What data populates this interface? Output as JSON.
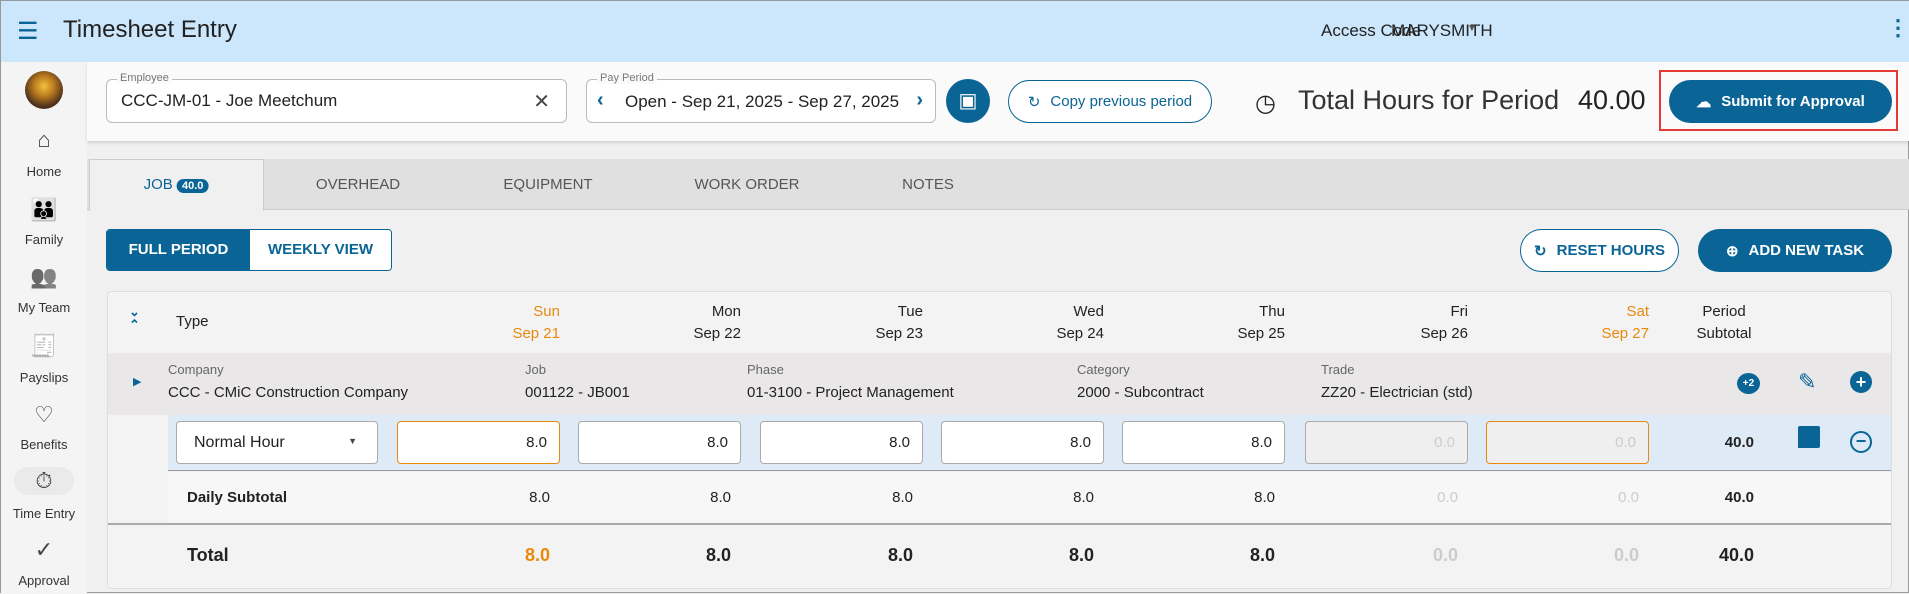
{
  "header": {
    "title": "Timesheet Entry",
    "access_code_label": "Access Code",
    "access_code_value": "MARYSMITH"
  },
  "sidebar": {
    "items": [
      {
        "label": "Home",
        "icon": "home-icon"
      },
      {
        "label": "Family",
        "icon": "family-icon"
      },
      {
        "label": "My Team",
        "icon": "team-icon"
      },
      {
        "label": "Payslips",
        "icon": "payslip-icon"
      },
      {
        "label": "Benefits",
        "icon": "benefits-icon"
      },
      {
        "label": "Time Entry",
        "icon": "timer-icon",
        "active": true
      },
      {
        "label": "Approval",
        "icon": "approval-icon"
      }
    ]
  },
  "toolbar": {
    "employee_label": "Employee",
    "employee_value": "CCC-JM-01 - Joe Meetchum",
    "pay_period_label": "Pay Period",
    "pay_period_value": "Open - Sep 21, 2025 - Sep 27, 2025",
    "copy_label": "Copy previous period",
    "total_label": "Total Hours for Period",
    "total_value": "40.00",
    "submit_label": "Submit for Approval"
  },
  "tabs": [
    {
      "label": "JOB",
      "badge": "40.0"
    },
    {
      "label": "OVERHEAD"
    },
    {
      "label": "EQUIPMENT"
    },
    {
      "label": "WORK ORDER"
    },
    {
      "label": "NOTES"
    }
  ],
  "view": {
    "full_period": "FULL PERIOD",
    "weekly": "WEEKLY VIEW",
    "reset": "RESET HOURS",
    "add_task": "ADD NEW TASK"
  },
  "table": {
    "type_label": "Type",
    "period_subtotal": [
      "Period",
      "Subtotal"
    ],
    "days": [
      {
        "day": "Sun",
        "date": "Sep 21",
        "weekend": true,
        "hours": "8.0",
        "subtotal": "8.0",
        "total": "8.0"
      },
      {
        "day": "Mon",
        "date": "Sep 22",
        "hours": "8.0",
        "subtotal": "8.0",
        "total": "8.0"
      },
      {
        "day": "Tue",
        "date": "Sep 23",
        "hours": "8.0",
        "subtotal": "8.0",
        "total": "8.0"
      },
      {
        "day": "Wed",
        "date": "Sep 24",
        "hours": "8.0",
        "subtotal": "8.0",
        "total": "8.0"
      },
      {
        "day": "Thu",
        "date": "Sep 25",
        "hours": "8.0",
        "subtotal": "8.0",
        "total": "8.0"
      },
      {
        "day": "Fri",
        "date": "Sep 26",
        "disabled": true,
        "hours": "0.0",
        "subtotal": "0.0",
        "total": "0.0"
      },
      {
        "day": "Sat",
        "date": "Sep 27",
        "weekend": true,
        "disabled": true,
        "hours": "0.0",
        "subtotal": "0.0",
        "total": "0.0"
      }
    ],
    "group": [
      {
        "label": "Company",
        "value": "CCC - CMiC Construction Company"
      },
      {
        "label": "Job",
        "value": "001122 - JB001"
      },
      {
        "label": "Phase",
        "value": "01-3100 - Project Management"
      },
      {
        "label": "Category",
        "value": "2000 - Subcontract"
      },
      {
        "label": "Trade",
        "value": "ZZ20 - Electrician (std)"
      }
    ],
    "more_badge": "+2",
    "hour_type": "Normal Hour",
    "row_total": "40.0",
    "daily_subtotal_label": "Daily Subtotal",
    "daily_subtotal_total": "40.0",
    "total_label": "Total",
    "grand_total": "40.0"
  },
  "colors": {
    "primary": "#0a6596",
    "weekend": "#e8890c",
    "header_bg": "#cce6fb",
    "highlight": "#e53935"
  }
}
